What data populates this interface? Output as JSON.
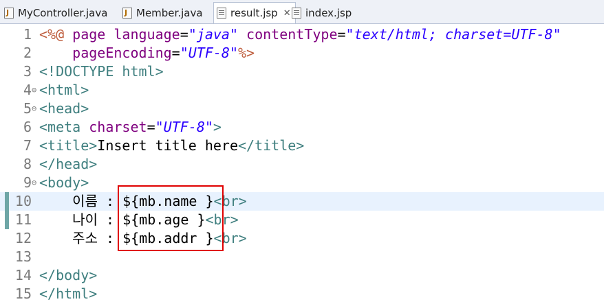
{
  "tabs": [
    {
      "label": "MyController.java",
      "icon": "java-file-icon"
    },
    {
      "label": "Member.java",
      "icon": "java-file-icon"
    },
    {
      "label": "result.jsp",
      "icon": "jsp-file-icon",
      "active": true,
      "close": "✕"
    },
    {
      "label": "index.jsp",
      "icon": "jsp-file-icon"
    }
  ],
  "editor": {
    "lines": [
      {
        "num": "1",
        "fold": "",
        "t": [
          "<%@",
          " page ",
          "language",
          "=",
          "\"java\"",
          " ",
          "contentType",
          "=",
          "\"text/html; charset=UTF-8\""
        ]
      },
      {
        "num": "2",
        "fold": "",
        "t": [
          "    ",
          "pageEncoding",
          "=",
          "\"UTF-8\"",
          "%>"
        ]
      },
      {
        "num": "3",
        "fold": "",
        "t": [
          "<!DOCTYPE html>"
        ]
      },
      {
        "num": "4",
        "fold": "⊖",
        "t": [
          "<html>"
        ]
      },
      {
        "num": "5",
        "fold": "⊖",
        "t": [
          "<head>"
        ]
      },
      {
        "num": "6",
        "fold": "",
        "t": [
          "<meta",
          " ",
          "charset",
          "=",
          "\"UTF-8\"",
          ">"
        ]
      },
      {
        "num": "7",
        "fold": "",
        "t": [
          "<title>",
          "Insert title here",
          "</title>"
        ]
      },
      {
        "num": "8",
        "fold": "",
        "t": [
          "</head>"
        ]
      },
      {
        "num": "9",
        "fold": "⊖",
        "t": [
          "<body>"
        ]
      },
      {
        "num": "10",
        "fold": "",
        "t": [
          "    이름 : ",
          "${mb.name }",
          "<br>"
        ]
      },
      {
        "num": "11",
        "fold": "",
        "t": [
          "    나이 : ",
          "${mb.age }",
          "<br>"
        ]
      },
      {
        "num": "12",
        "fold": "",
        "t": [
          "    주소 : ",
          "${mb.addr }",
          "<br>"
        ]
      },
      {
        "num": "13",
        "fold": "",
        "t": [
          ""
        ]
      },
      {
        "num": "14",
        "fold": "",
        "t": [
          "</body>"
        ]
      },
      {
        "num": "15",
        "fold": "",
        "t": [
          "</html>"
        ]
      }
    ]
  },
  "colors": {
    "tag": "#3f7f7f",
    "attribute": "#7f007f",
    "string": "#2a00ff",
    "directive": "#bf5f3f",
    "highlight": "#e8f2fe",
    "annotation_box": "#e00000"
  }
}
